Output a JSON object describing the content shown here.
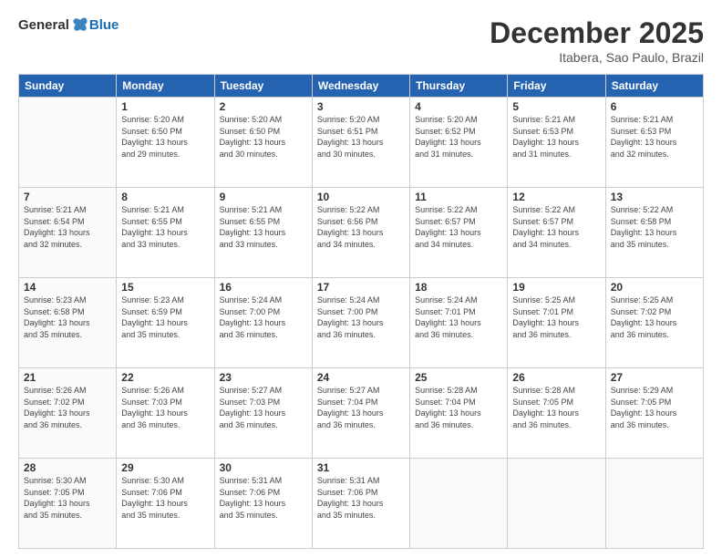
{
  "header": {
    "logo": {
      "general": "General",
      "blue": "Blue"
    },
    "title": "December 2025",
    "subtitle": "Itabera, Sao Paulo, Brazil"
  },
  "weekdays": [
    "Sunday",
    "Monday",
    "Tuesday",
    "Wednesday",
    "Thursday",
    "Friday",
    "Saturday"
  ],
  "weeks": [
    [
      {
        "day": "",
        "info": ""
      },
      {
        "day": "1",
        "info": "Sunrise: 5:20 AM\nSunset: 6:50 PM\nDaylight: 13 hours\nand 29 minutes."
      },
      {
        "day": "2",
        "info": "Sunrise: 5:20 AM\nSunset: 6:50 PM\nDaylight: 13 hours\nand 30 minutes."
      },
      {
        "day": "3",
        "info": "Sunrise: 5:20 AM\nSunset: 6:51 PM\nDaylight: 13 hours\nand 30 minutes."
      },
      {
        "day": "4",
        "info": "Sunrise: 5:20 AM\nSunset: 6:52 PM\nDaylight: 13 hours\nand 31 minutes."
      },
      {
        "day": "5",
        "info": "Sunrise: 5:21 AM\nSunset: 6:53 PM\nDaylight: 13 hours\nand 31 minutes."
      },
      {
        "day": "6",
        "info": "Sunrise: 5:21 AM\nSunset: 6:53 PM\nDaylight: 13 hours\nand 32 minutes."
      }
    ],
    [
      {
        "day": "7",
        "info": "Sunrise: 5:21 AM\nSunset: 6:54 PM\nDaylight: 13 hours\nand 32 minutes."
      },
      {
        "day": "8",
        "info": "Sunrise: 5:21 AM\nSunset: 6:55 PM\nDaylight: 13 hours\nand 33 minutes."
      },
      {
        "day": "9",
        "info": "Sunrise: 5:21 AM\nSunset: 6:55 PM\nDaylight: 13 hours\nand 33 minutes."
      },
      {
        "day": "10",
        "info": "Sunrise: 5:22 AM\nSunset: 6:56 PM\nDaylight: 13 hours\nand 34 minutes."
      },
      {
        "day": "11",
        "info": "Sunrise: 5:22 AM\nSunset: 6:57 PM\nDaylight: 13 hours\nand 34 minutes."
      },
      {
        "day": "12",
        "info": "Sunrise: 5:22 AM\nSunset: 6:57 PM\nDaylight: 13 hours\nand 34 minutes."
      },
      {
        "day": "13",
        "info": "Sunrise: 5:22 AM\nSunset: 6:58 PM\nDaylight: 13 hours\nand 35 minutes."
      }
    ],
    [
      {
        "day": "14",
        "info": "Sunrise: 5:23 AM\nSunset: 6:58 PM\nDaylight: 13 hours\nand 35 minutes."
      },
      {
        "day": "15",
        "info": "Sunrise: 5:23 AM\nSunset: 6:59 PM\nDaylight: 13 hours\nand 35 minutes."
      },
      {
        "day": "16",
        "info": "Sunrise: 5:24 AM\nSunset: 7:00 PM\nDaylight: 13 hours\nand 36 minutes."
      },
      {
        "day": "17",
        "info": "Sunrise: 5:24 AM\nSunset: 7:00 PM\nDaylight: 13 hours\nand 36 minutes."
      },
      {
        "day": "18",
        "info": "Sunrise: 5:24 AM\nSunset: 7:01 PM\nDaylight: 13 hours\nand 36 minutes."
      },
      {
        "day": "19",
        "info": "Sunrise: 5:25 AM\nSunset: 7:01 PM\nDaylight: 13 hours\nand 36 minutes."
      },
      {
        "day": "20",
        "info": "Sunrise: 5:25 AM\nSunset: 7:02 PM\nDaylight: 13 hours\nand 36 minutes."
      }
    ],
    [
      {
        "day": "21",
        "info": "Sunrise: 5:26 AM\nSunset: 7:02 PM\nDaylight: 13 hours\nand 36 minutes."
      },
      {
        "day": "22",
        "info": "Sunrise: 5:26 AM\nSunset: 7:03 PM\nDaylight: 13 hours\nand 36 minutes."
      },
      {
        "day": "23",
        "info": "Sunrise: 5:27 AM\nSunset: 7:03 PM\nDaylight: 13 hours\nand 36 minutes."
      },
      {
        "day": "24",
        "info": "Sunrise: 5:27 AM\nSunset: 7:04 PM\nDaylight: 13 hours\nand 36 minutes."
      },
      {
        "day": "25",
        "info": "Sunrise: 5:28 AM\nSunset: 7:04 PM\nDaylight: 13 hours\nand 36 minutes."
      },
      {
        "day": "26",
        "info": "Sunrise: 5:28 AM\nSunset: 7:05 PM\nDaylight: 13 hours\nand 36 minutes."
      },
      {
        "day": "27",
        "info": "Sunrise: 5:29 AM\nSunset: 7:05 PM\nDaylight: 13 hours\nand 36 minutes."
      }
    ],
    [
      {
        "day": "28",
        "info": "Sunrise: 5:30 AM\nSunset: 7:05 PM\nDaylight: 13 hours\nand 35 minutes."
      },
      {
        "day": "29",
        "info": "Sunrise: 5:30 AM\nSunset: 7:06 PM\nDaylight: 13 hours\nand 35 minutes."
      },
      {
        "day": "30",
        "info": "Sunrise: 5:31 AM\nSunset: 7:06 PM\nDaylight: 13 hours\nand 35 minutes."
      },
      {
        "day": "31",
        "info": "Sunrise: 5:31 AM\nSunset: 7:06 PM\nDaylight: 13 hours\nand 35 minutes."
      },
      {
        "day": "",
        "info": ""
      },
      {
        "day": "",
        "info": ""
      },
      {
        "day": "",
        "info": ""
      }
    ]
  ]
}
